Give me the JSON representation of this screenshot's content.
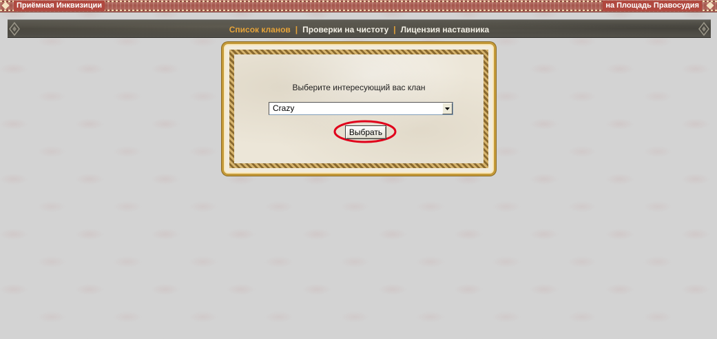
{
  "top_bar": {
    "left_link": "Приёмная Инквизиции",
    "right_link": "на Площадь Правосудия"
  },
  "nav": {
    "items": [
      {
        "label": "Список кланов",
        "active": true
      },
      {
        "label": "Проверки на чистоту",
        "active": false
      },
      {
        "label": "Лицензия наставника",
        "active": false
      }
    ],
    "separator": "|"
  },
  "panel": {
    "prompt": "Выберите интересующий вас клан",
    "clan_select": {
      "selected": "Crazy"
    },
    "submit_label": "Выбрать",
    "highlight_color": "#e0001b"
  },
  "colors": {
    "nav_active": "#e6a43a",
    "top_bar": "#a4564c",
    "frame_gold": "#c49a3a"
  }
}
